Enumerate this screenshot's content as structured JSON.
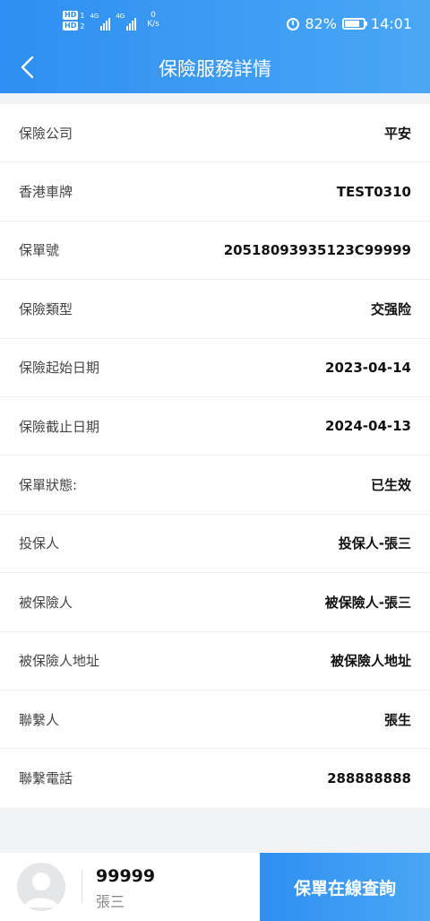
{
  "statusbar": {
    "hd1": "HD",
    "hd1_num": "1",
    "hd2": "HD",
    "hd2_num": "2",
    "net1": "4G",
    "net2": "4G",
    "speed_value": "0",
    "speed_unit": "K/s",
    "battery": "82%",
    "battery_level": 0.82,
    "time": "14:01"
  },
  "header": {
    "title": "保險服務詳情",
    "back_icon": "chevron-left-icon"
  },
  "details": [
    {
      "label": "保險公司",
      "value": "平安"
    },
    {
      "label": "香港車牌",
      "value": "TEST0310"
    },
    {
      "label": "保單號",
      "value": "20518093935123C99999"
    },
    {
      "label": "保險類型",
      "value": "交强险"
    },
    {
      "label": "保險起始日期",
      "value": "2023-04-14"
    },
    {
      "label": "保險截止日期",
      "value": "2024-04-13"
    },
    {
      "label": "保單狀態:",
      "value": "已生效"
    },
    {
      "label": "投保人",
      "value": "投保人-張三"
    },
    {
      "label": "被保險人",
      "value": "被保險人-張三"
    },
    {
      "label": "被保險人地址",
      "value": "被保險人地址"
    },
    {
      "label": "聯繫人",
      "value": "張生"
    },
    {
      "label": "聯繫電話",
      "value": "288888888"
    }
  ],
  "bottom": {
    "user_id": "99999",
    "user_name": "張三",
    "query_button": "保單在線查詢"
  },
  "colors": {
    "accent": "#2f8ff2",
    "accent_light": "#4aa7f5",
    "background": "#f2f3f5"
  }
}
